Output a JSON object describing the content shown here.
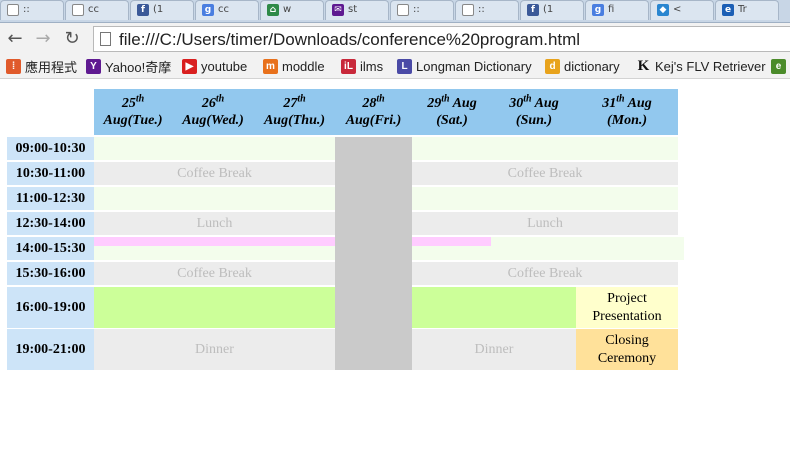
{
  "tabs": [
    {
      "icon": "page-icon",
      "title": "::"
    },
    {
      "icon": "page-icon",
      "title": "cc"
    },
    {
      "icon": "facebook-icon",
      "title": "(1"
    },
    {
      "icon": "google-icon",
      "title": "cc"
    },
    {
      "icon": "home-icon",
      "title": "w"
    },
    {
      "icon": "mail-icon",
      "title": "st"
    },
    {
      "icon": "page-icon",
      "title": "::"
    },
    {
      "icon": "page-icon",
      "title": "::"
    },
    {
      "icon": "facebook-icon",
      "title": "(1"
    },
    {
      "icon": "google-icon",
      "title": "fi"
    },
    {
      "icon": "chat-icon",
      "title": "<"
    },
    {
      "icon": "ie-icon",
      "title": "Tr"
    }
  ],
  "toolbar": {
    "url": "file:///C:/Users/timer/Downloads/conference%20program.html"
  },
  "bookmarks": [
    {
      "label": "應用程式",
      "icon": "apps-grid-icon",
      "color": "#e05a2b"
    },
    {
      "label": "Yahoo!奇摩",
      "icon": "yahoo-icon",
      "color": "#5f1a91"
    },
    {
      "label": "youtube",
      "icon": "youtube-icon",
      "color": "#d91f1f"
    },
    {
      "label": "moddle",
      "icon": "moodle-icon",
      "color": "#e8711c"
    },
    {
      "label": "ilms",
      "icon": "ilms-icon",
      "color": "#c8283a"
    },
    {
      "label": "Longman Dictionary",
      "icon": "longman-icon",
      "color": "#4a4aa6"
    },
    {
      "label": "dictionary",
      "icon": "dictionary-icon",
      "color": "#e8a31c"
    },
    {
      "label": "Kej's FLV Retriever",
      "icon": "k-icon",
      "color": "#222222"
    },
    {
      "label": "",
      "icon": "evernote-icon",
      "color": "#4b8b2a"
    }
  ],
  "schedule": {
    "days": [
      {
        "num": "25",
        "sup": "th",
        "name": "Aug(Tue.)"
      },
      {
        "num": "26",
        "sup": "th",
        "name": "Aug(Wed.)"
      },
      {
        "num": "27",
        "sup": "th",
        "name": "Aug(Thu.)"
      },
      {
        "num": "28",
        "sup": "th",
        "name": "Aug(Fri.)"
      },
      {
        "num": "29",
        "sup": "th",
        "name": "Aug",
        "sub": "(Sat.)"
      },
      {
        "num": "30",
        "sup": "th",
        "name": "Aug",
        "sub": "(Sun.)"
      },
      {
        "num": "31",
        "sup": "th",
        "name": "Aug",
        "sub": "(Mon.)"
      }
    ],
    "times": [
      "09:00-10:30",
      "10:30-11:00",
      "11:00-12:30",
      "12:30-14:00",
      "14:00-15:30",
      "15:30-16:00",
      "16:00-19:00",
      "19:00-21:00"
    ],
    "coffee_break": "Coffee Break",
    "lunch": "Lunch",
    "dinner": "Dinner",
    "project_presentation": "Project Presentation",
    "closing_ceremony": "Closing Ceremony"
  },
  "colors": {
    "header": "#92c8ee",
    "time": "#cde4f8",
    "session": "#f3fdec",
    "break": "#ececec",
    "pink": "#ffccff",
    "green": "#ccff99",
    "closed": "#cacaca",
    "project": "#ffffcc",
    "closing": "#ffe19a"
  }
}
